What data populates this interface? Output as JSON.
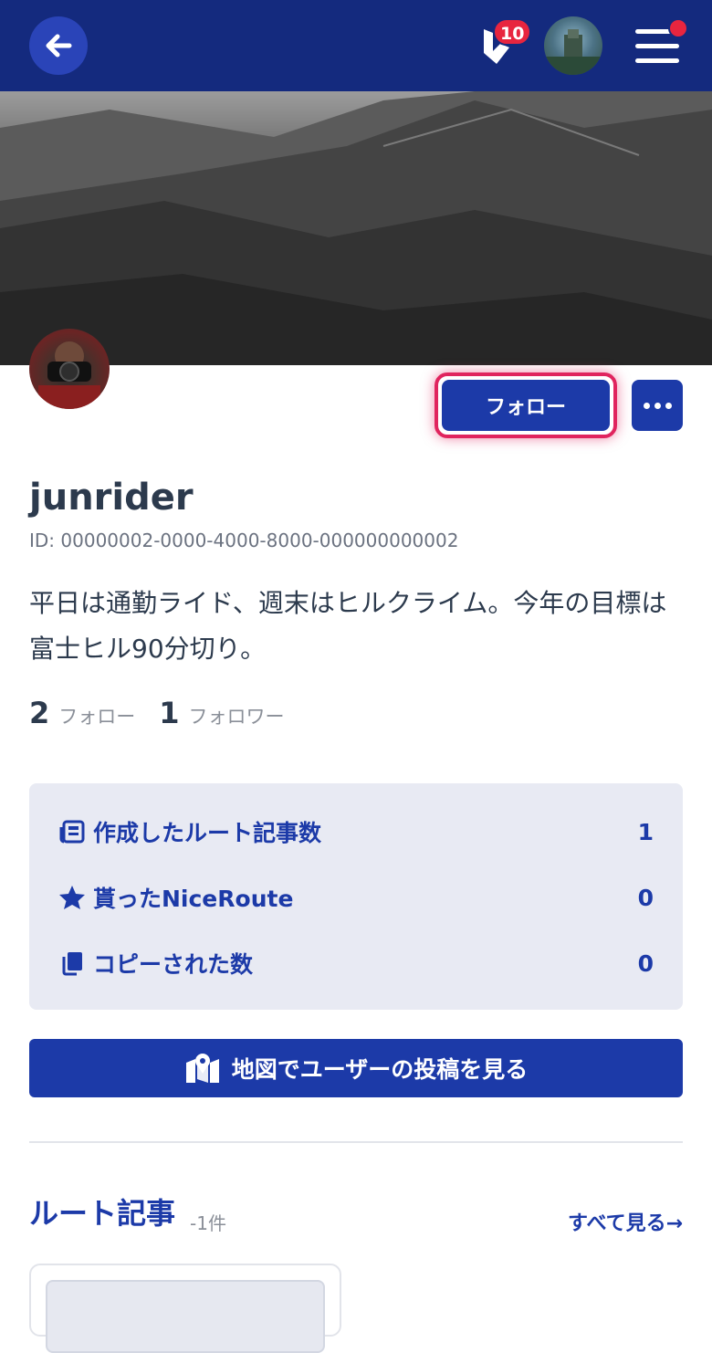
{
  "header": {
    "notification_count": "10",
    "colors": {
      "bar": "#142a7e",
      "badge": "#e8253f"
    }
  },
  "profile": {
    "follow_label": "フォロー",
    "username": "junrider",
    "id_text": "ID: 00000002-0000-4000-8000-000000000002",
    "bio": "平日は通勤ライド、週末はヒルクライム。今年の目標は富士ヒル90分切り。",
    "following_count": "2",
    "following_label": "フォロー",
    "followers_count": "1",
    "followers_label": "フォロワー"
  },
  "stats": [
    {
      "icon": "article-icon",
      "label": "作成したルート記事数",
      "value": "1"
    },
    {
      "icon": "star-icon",
      "label": "貰ったNiceRoute",
      "value": "0"
    },
    {
      "icon": "copy-icon",
      "label": "コピーされた数",
      "value": "0"
    }
  ],
  "map_button_label": "地図でユーザーの投稿を見る",
  "routes_section": {
    "title": "ルート記事",
    "count": "-1件",
    "see_all": "すべて見る→"
  },
  "colors": {
    "primary": "#1c3aa8",
    "highlight": "#e0245e",
    "stats_bg": "#e8eaf3"
  }
}
